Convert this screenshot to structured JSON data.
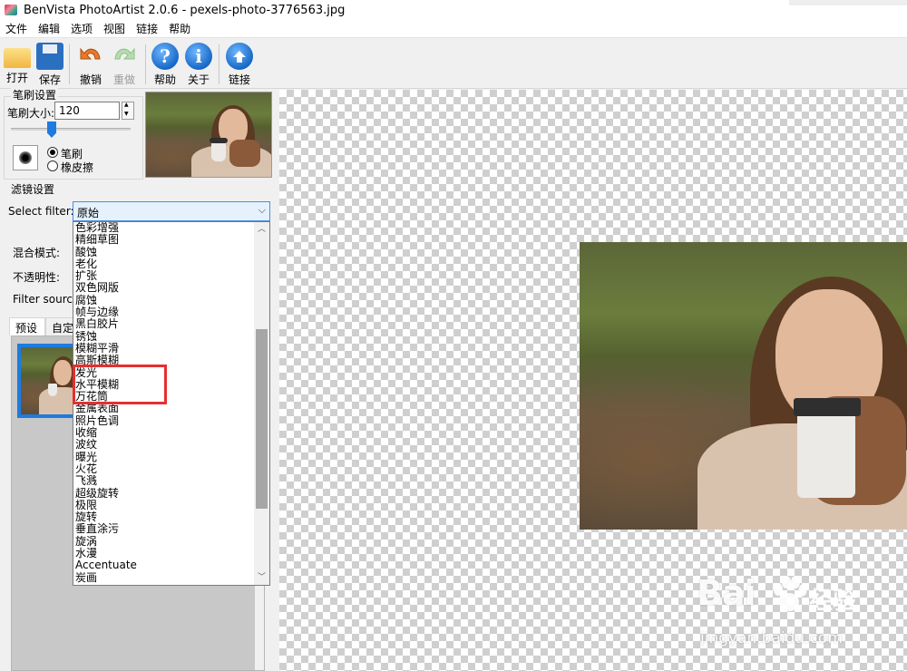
{
  "window": {
    "title": "BenVista PhotoArtist 2.0.6 - pexels-photo-3776563.jpg"
  },
  "menu": [
    "文件",
    "编辑",
    "选项",
    "视图",
    "链接",
    "帮助"
  ],
  "toolbar": {
    "open": "打开",
    "save": "保存",
    "undo": "撤销",
    "redo": "重做",
    "help": "帮助",
    "about": "关于",
    "link": "链接"
  },
  "brush": {
    "group": "笔刷设置",
    "size_label": "笔刷大小:",
    "size_value": "120",
    "brush_option": "笔刷",
    "eraser_option": "橡皮擦",
    "selected": "笔刷"
  },
  "filter": {
    "group": "滤镜设置",
    "select_label": "Select filter:",
    "selected": "原始",
    "blend_label": "混合模式:",
    "opacity_label": "不透明性:",
    "source_label": "Filter source:",
    "options": [
      "色彩增强",
      "精细草图",
      "酸蚀",
      "老化",
      "扩张",
      "双色网版",
      "腐蚀",
      "帧与边缘",
      "黑白胶片",
      "锈蚀",
      "模糊平滑",
      "高斯模糊",
      "发光",
      "水平模糊",
      "万花筒",
      "金属表面",
      "照片色调",
      "收缩",
      "波纹",
      "曝光",
      "火花",
      "飞溅",
      "超级旋转",
      "极限",
      "旋转",
      "垂直涂污",
      "旋涡",
      "水漫",
      "Accentuate",
      "炭画"
    ]
  },
  "tabs": [
    "预设",
    "自定"
  ],
  "watermark": {
    "brand": "Bai",
    "brand_cn": "经验",
    "url": "jingyan.baidu.com"
  },
  "colors": {
    "accent": "#1e7be0",
    "highlight": "#e53030",
    "select_bg": "#e5f1fb"
  }
}
